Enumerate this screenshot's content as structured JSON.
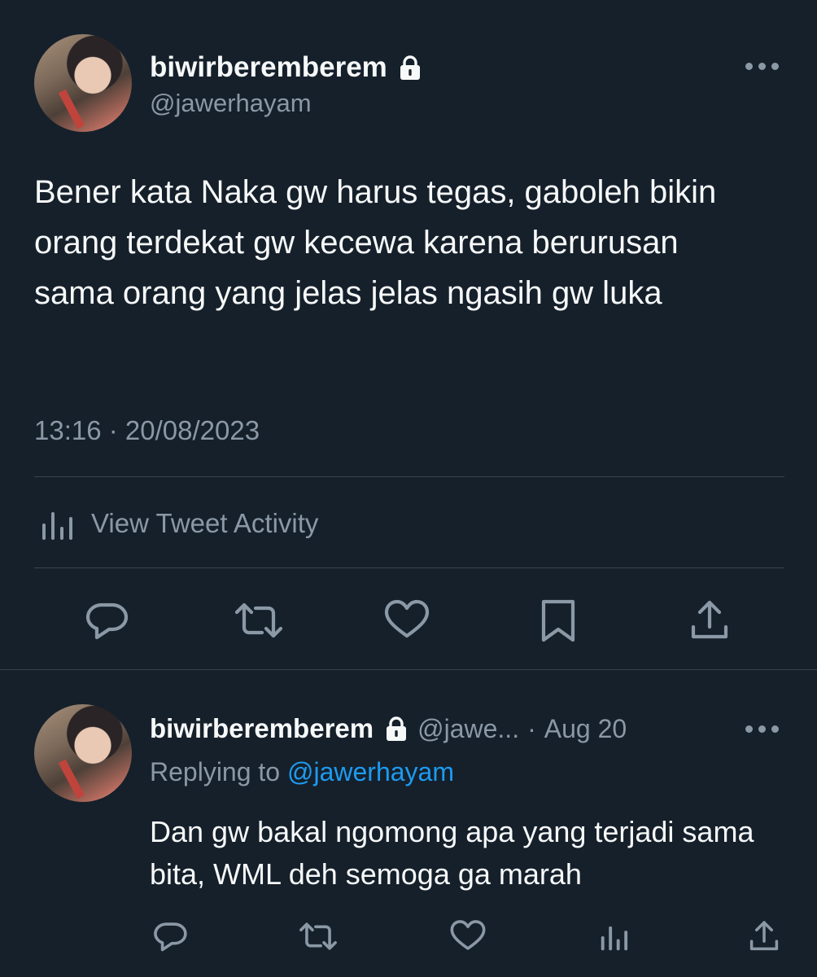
{
  "main_tweet": {
    "display_name": "biwirberemberem",
    "handle": "@jawerhayam",
    "text": "Bener kata Naka gw harus tegas, gaboleh bikin orang terdekat gw kecewa karena berurusan sama orang yang jelas jelas ngasih gw luka",
    "timestamp": "13:16 · 20/08/2023",
    "activity_label": "View Tweet Activity",
    "icons": {
      "lock": "lock-icon",
      "more": "more-icon",
      "activity": "analytics-icon",
      "reply": "reply-icon",
      "retweet": "retweet-icon",
      "like": "like-icon",
      "bookmark": "bookmark-icon",
      "share": "share-icon"
    }
  },
  "reply_tweet": {
    "display_name": "biwirberemberem",
    "handle": "@jawe...",
    "separator": "·",
    "date": "Aug 20",
    "replying_prefix": "Replying to",
    "replying_handle": "@jawerhayam",
    "text": "Dan gw bakal ngomong apa yang terjadi sama bita, WML deh semoga ga marah",
    "icons": {
      "reply": "reply-icon",
      "retweet": "retweet-icon",
      "like": "like-icon",
      "analytics": "analytics-icon",
      "share": "share-icon"
    }
  },
  "colors": {
    "background": "#15202b",
    "text": "#f7f9f9",
    "muted": "#8b98a5",
    "link": "#1d9bf0",
    "divider": "#38444d"
  }
}
